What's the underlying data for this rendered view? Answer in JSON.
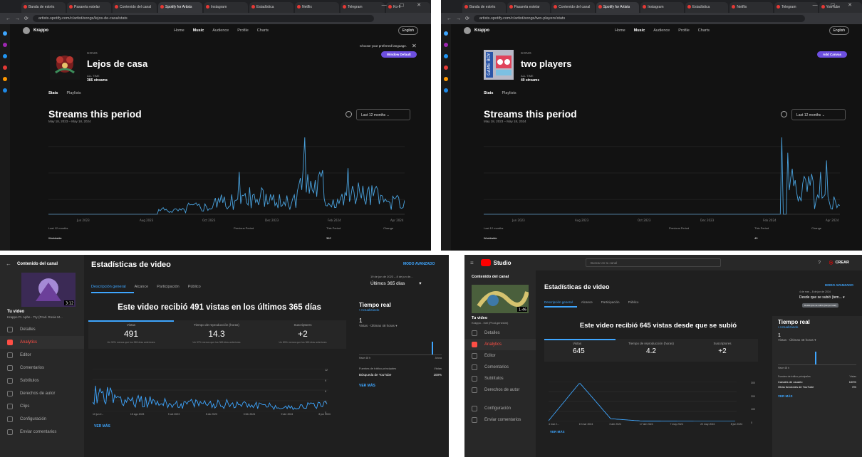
{
  "top_left": {
    "tabs": [
      "Banda de estrés",
      "Pasarela estelar",
      "Contenido del canal",
      "Spotify for Artists",
      "Instagram",
      "Estadística",
      "Netflix",
      "Telegram",
      "Ko-fi"
    ],
    "url": "artists.spotify.com/c/artist/songs/lejos-de-casa/stats",
    "artist_name": "Krappo",
    "nav": [
      "Home",
      "Music",
      "Audience",
      "Profile",
      "Charts"
    ],
    "nav_active": "Music",
    "lang_button": "English",
    "language_prompt": "Choose your preferred language.",
    "language_pill": "Window Default",
    "song_kind": "SONG",
    "song_title": "Lejos de casa",
    "streams_label": "ALL TIME",
    "streams_value": "366 streams",
    "subtabs": [
      "Stats",
      "Playlists"
    ],
    "period_title": "Streams this period",
    "period_range": "May 18, 2023 – May 18, 2024",
    "range_select": "Last 12 months",
    "x_labels": [
      "Jun 2023",
      "Aug 2023",
      "Oct 2023",
      "Dec 2023",
      "Feb 2024",
      "Apr 2024"
    ],
    "footer_left": "Last 12 months",
    "footer_mid": "Previous Period",
    "footer_right1": "This Period",
    "footer_right2": "Change",
    "footer_row": "Worldwide",
    "footer_value": "362"
  },
  "top_right": {
    "tabs": [
      "Banda de estrés",
      "Pasarela estelar",
      "Contenido del canal",
      "Spotify for Artists",
      "Instagram",
      "Estadística",
      "Netflix",
      "Telegram",
      "YouTube"
    ],
    "url": "artists.spotify.com/c/artist/songs/two-players/stats",
    "artist_name": "Krappo",
    "nav": [
      "Home",
      "Music",
      "Audience",
      "Profile",
      "Charts"
    ],
    "nav_active": "Music",
    "lang_button": "English",
    "pill": "Add Canvas",
    "song_kind": "SONG",
    "song_title": "two players",
    "streams_label": "ALL TIME",
    "streams_value": "40 streams",
    "subtabs": [
      "Stats",
      "Playlists"
    ],
    "period_title": "Streams this period",
    "period_range": "May 18, 2023 – May 18, 2024",
    "range_select": "Last 12 months",
    "x_labels": [
      "Jun 2023",
      "Aug 2023",
      "Oct 2023",
      "Dec 2023",
      "Feb 2024",
      "Apr 2024"
    ],
    "footer_left": "Last 12 months",
    "footer_mid": "Previous Period",
    "footer_right1": "This Period",
    "footer_right2": "Change",
    "footer_row": "Worldwide",
    "footer_value": "40"
  },
  "bottom_left": {
    "channel_content": "Contenido del canal",
    "thumb_duration": "3:12",
    "your_video": "Tu video",
    "video_name": "Krappo Ft. Aphe - Try (Prod. Rosie M...",
    "nav": [
      "Detalles",
      "Analytics",
      "Editor",
      "Comentarios",
      "Subtítulos",
      "Derechos de autor",
      "Clips",
      "Configuración",
      "Enviar comentarios"
    ],
    "nav_active": "Analytics",
    "title": "Estadísticas de video",
    "advanced": "MODO AVANZADO",
    "date_range_small": "19 de jun de 2023 – 8 de jun de...",
    "date_range": "Últimos 365 días",
    "tabs": [
      "Descripción general",
      "Alcance",
      "Participación",
      "Público"
    ],
    "headline": "Este video recibió 491 vistas en los últimos 365 días",
    "metrics": [
      {
        "label": "Vistas",
        "value": "491",
        "sub": "Un 32% menos que los 365 días anteriores"
      },
      {
        "label": "Tiempo de reproducción (horas)",
        "value": "14.3",
        "sub": "Un 37% menos que los 365 días anteriores"
      },
      {
        "label": "Suscriptores",
        "value": "+2",
        "sub": "Un 89% menos que los 365 días anteriores"
      }
    ],
    "x_labels": [
      "10 jun 2...",
      "15 ago 2023",
      "9 oct 2023",
      "5 dic 2023",
      "3 feb 2024",
      "9 abr 2024",
      "8 jun 2024"
    ],
    "y_labels": [
      "12",
      "9",
      "6",
      "3",
      "0"
    ],
    "see_more": "VER MÁS",
    "realtime_title": "Tiempo real",
    "realtime_sub": "• Actualizando",
    "realtime_value": "1",
    "realtime_caption": "Vistas · Últimas 48 horas",
    "rt_left": "Hace 48 h",
    "rt_right": "Ahora",
    "top_sources_label": "Fuentes de tráfico principales",
    "views_label": "Vistas",
    "source_name": "Búsqueda de YouTube",
    "source_pct": "100%",
    "see_more_2": "VER MÁS"
  },
  "bottom_right": {
    "studio": "Studio",
    "search_placeholder": "Buscar en tu canal",
    "create": "CREAR",
    "channel_content": "Contenido del canal",
    "thumb_duration": "1:46",
    "your_video": "Tu video",
    "video_name": "Krappo - Inel (Prod.genesim)",
    "nav": [
      "Detalles",
      "Analytics",
      "Editor",
      "Comentarios",
      "Subtítulos",
      "Derechos de autor",
      "Configuración",
      "Enviar comentarios"
    ],
    "nav_active": "Analytics",
    "title": "Estadísticas de video",
    "advanced": "MODO AVANZADO",
    "date_range_small": "4 de mar – 8 de jun de 2024",
    "date_range": "Desde que se subió (tem...",
    "tooltip": "Desde que se subió (tiempo total)",
    "tabs": [
      "Descripción general",
      "Alcance",
      "Participación",
      "Público"
    ],
    "headline": "Este video recibió 645 vistas desde que se subió",
    "metrics": [
      {
        "label": "Vistas",
        "value": "645"
      },
      {
        "label": "Tiempo de reproducción (horas)",
        "value": "4.2"
      },
      {
        "label": "Suscriptores",
        "value": "+2"
      }
    ],
    "x_labels": [
      "4 mar 2...",
      "19 mar 2024",
      "3 abr 2024",
      "17 abr 2024",
      "7 may 2024",
      "22 may 2024",
      "8 jun 2024"
    ],
    "y_labels": [
      "300",
      "200",
      "100",
      "0"
    ],
    "see_more": "VER MÁS",
    "realtime_title": "Tiempo real",
    "realtime_sub": "• Actualizando",
    "realtime_value": "1",
    "realtime_caption": "Vistas · Últimas 48 horas",
    "rt_left": "Hace 48 h",
    "top_sources_label": "Fuentes de tráfico principales",
    "views_label": "Vistas",
    "sources": [
      {
        "name": "Canales de usuario",
        "pct": "100%"
      },
      {
        "name": "Otras funciones de YouTube",
        "pct": "0%"
      }
    ],
    "see_more_2": "VER MÁS"
  },
  "colors": {
    "spotify_line": "#4aa3df",
    "yt_line": "#3ea6ff",
    "accent_purple": "#6d4fe0",
    "yt_red": "#ff0000"
  },
  "chart_data": [
    {
      "type": "line",
      "name": "Lejos de casa daily streams",
      "x": [
        "2023-05",
        "2023-06",
        "2023-07",
        "2023-08",
        "2023-09",
        "2023-10",
        "2023-11",
        "2023-12",
        "2024-01",
        "2024-02",
        "2024-03",
        "2024-04",
        "2024-05"
      ],
      "values": [
        0,
        0,
        0,
        0,
        1,
        2,
        3,
        4,
        3,
        8,
        4,
        5,
        3
      ],
      "peak": 8
    },
    {
      "type": "line",
      "name": "two players daily streams",
      "x": [
        "2023-05",
        "2023-06",
        "2023-07",
        "2023-08",
        "2023-09",
        "2023-10",
        "2023-11",
        "2023-12",
        "2024-01",
        "2024-02",
        "2024-03",
        "2024-04",
        "2024-05"
      ],
      "values": [
        0,
        0,
        0,
        0,
        0,
        0,
        0,
        0,
        0,
        0,
        0,
        6,
        3
      ],
      "peak": 7
    },
    {
      "type": "line",
      "name": "Vistas (491)",
      "ylim": [
        0,
        12
      ],
      "x": [
        "2023-06-10",
        "2023-08-15",
        "2023-10-09",
        "2023-12-05",
        "2024-02-03",
        "2024-04-09",
        "2024-06-08"
      ],
      "values": [
        5,
        3,
        2,
        2,
        2,
        1,
        2
      ]
    },
    {
      "type": "line",
      "name": "Vistas (645)",
      "ylim": [
        0,
        300
      ],
      "x": [
        "2024-03-04",
        "2024-03-19",
        "2024-04-03",
        "2024-04-17",
        "2024-05-07",
        "2024-05-22",
        "2024-06-08"
      ],
      "values": [
        5,
        290,
        20,
        3,
        2,
        1,
        1
      ]
    }
  ]
}
